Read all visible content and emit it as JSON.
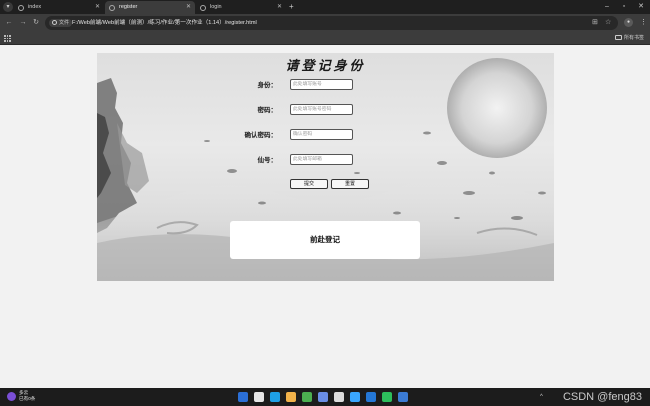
{
  "browser": {
    "tabs": [
      {
        "title": "index",
        "active": false
      },
      {
        "title": "register",
        "active": true
      },
      {
        "title": "login",
        "active": false
      }
    ],
    "address": {
      "security_label": "文件",
      "url": "F:/Web前端/Web前端（前测）/练习/作业/第一次作业（1.14）/register.html"
    },
    "bookmarks_label": "所有书签"
  },
  "page": {
    "title": "请登记身份",
    "fields": [
      {
        "label": "身份：",
        "placeholder": "此处填写账号"
      },
      {
        "label": "密码：",
        "placeholder": "此处填写账号密码"
      },
      {
        "label": "确认密码：",
        "placeholder": "确认密码"
      },
      {
        "label": "仙号：",
        "placeholder": "此处填写邮箱"
      }
    ],
    "submit_label": "提交",
    "reset_label": "重置",
    "login_link": "前赴登记"
  },
  "taskbar": {
    "weather_line1": "多云",
    "weather_line2": "已有0条"
  },
  "watermark": "CSDN @feng83",
  "colors": {
    "chrome_dark": "#1f1f1f",
    "toolbar": "#3c3c3c",
    "page_bg": "#f2f2f2",
    "form_text": "#1a1a1a",
    "card": "#ffffff"
  },
  "icons": [
    "tab-menu-icon",
    "close-icon",
    "new-tab-icon",
    "minimize-icon",
    "maximize-icon",
    "back-icon",
    "forward-icon",
    "reload-icon",
    "info-icon",
    "translate-icon",
    "star-icon",
    "profile-icon",
    "menu-icon",
    "apps-icon",
    "folder-icon"
  ]
}
